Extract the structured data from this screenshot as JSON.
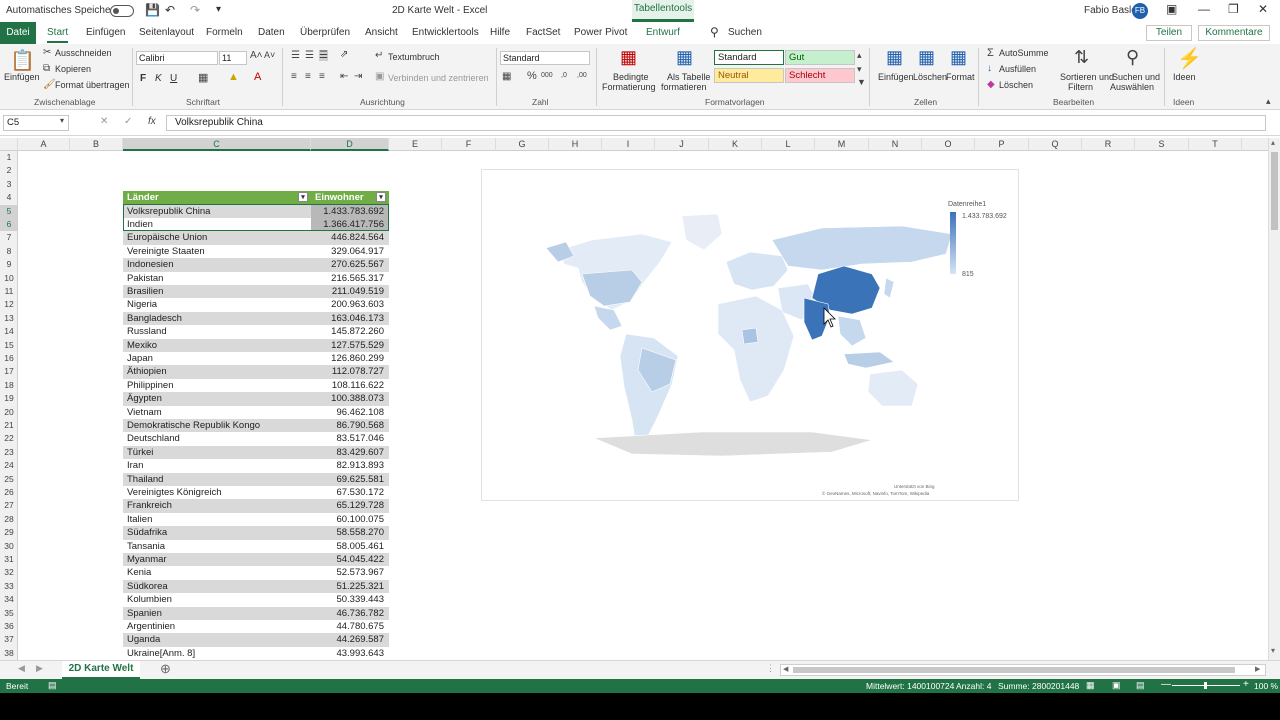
{
  "titlebar": {
    "autosave_label": "Automatisches Speichern",
    "doc_title": "2D Karte Welt  -  Excel",
    "context_tab": "Tabellentools",
    "user_name": "Fabio Basler",
    "user_initials": "FB"
  },
  "tabs": {
    "file": "Datei",
    "start": "Start",
    "insert": "Einfügen",
    "layout": "Seitenlayout",
    "formulas": "Formeln",
    "data": "Daten",
    "review": "Überprüfen",
    "view": "Ansicht",
    "developer": "Entwicklertools",
    "help": "Hilfe",
    "factset": "FactSet",
    "powerpivot": "Power Pivot",
    "design": "Entwurf",
    "search": "Suchen",
    "share": "Teilen",
    "comments": "Kommentare"
  },
  "ribbon": {
    "clipboard": {
      "paste": "Einfügen",
      "cut": "Ausschneiden",
      "copy": "Kopieren",
      "format_painter": "Format übertragen",
      "group": "Zwischenablage"
    },
    "font": {
      "name": "Calibri",
      "size": "11",
      "bold": "F",
      "italic": "K",
      "underline": "U",
      "group": "Schriftart"
    },
    "alignment": {
      "wrap": "Textumbruch",
      "merge": "Verbinden und zentrieren",
      "group": "Ausrichtung"
    },
    "number": {
      "format": "Standard",
      "group": "Zahl"
    },
    "styles": {
      "conditional": "Bedingte",
      "conditional2": "Formatierung",
      "as_table": "Als Tabelle",
      "as_table2": "formatieren",
      "standard": "Standard",
      "good": "Gut",
      "neutral": "Neutral",
      "bad": "Schlecht",
      "group": "Formatvorlagen"
    },
    "cells": {
      "insert": "Einfügen",
      "delete": "Löschen",
      "format": "Format",
      "group": "Zellen"
    },
    "editing": {
      "autosum": "AutoSumme",
      "fill": "Ausfüllen",
      "clear": "Löschen",
      "sort": "Sortieren und",
      "sort2": "Filtern",
      "find": "Suchen und",
      "find2": "Auswählen",
      "group": "Bearbeiten"
    },
    "ideas": {
      "label": "Ideen",
      "group": "Ideen"
    }
  },
  "formula_bar": {
    "name_box": "C5",
    "fx": "fx",
    "value": "Volksrepublik China"
  },
  "columns": [
    "A",
    "B",
    "C",
    "D",
    "E",
    "F",
    "G",
    "H",
    "I",
    "J",
    "K",
    "L",
    "M",
    "N",
    "O",
    "P",
    "Q",
    "R",
    "S",
    "T"
  ],
  "rows": [
    "1",
    "2",
    "3",
    "4",
    "5",
    "6",
    "7",
    "8",
    "9",
    "10",
    "11",
    "12",
    "13",
    "14",
    "15",
    "16",
    "17",
    "18",
    "19",
    "20",
    "21",
    "22",
    "23",
    "24",
    "25",
    "26",
    "27",
    "28",
    "29",
    "30",
    "31",
    "32",
    "33",
    "34",
    "35",
    "36",
    "37",
    "38"
  ],
  "table": {
    "headers": [
      "Länder",
      "Einwohner"
    ],
    "rows": [
      [
        "Volksrepublik China",
        "1.433.783.692"
      ],
      [
        "Indien",
        "1.366.417.756"
      ],
      [
        "Europäische Union",
        "446.824.564"
      ],
      [
        "Vereinigte Staaten",
        "329.064.917"
      ],
      [
        "Indonesien",
        "270.625.567"
      ],
      [
        "Pakistan",
        "216.565.317"
      ],
      [
        "Brasilien",
        "211.049.519"
      ],
      [
        "Nigeria",
        "200.963.603"
      ],
      [
        "Bangladesch",
        "163.046.173"
      ],
      [
        "Russland",
        "145.872.260"
      ],
      [
        "Mexiko",
        "127.575.529"
      ],
      [
        "Japan",
        "126.860.299"
      ],
      [
        "Äthiopien",
        "112.078.727"
      ],
      [
        "Philippinen",
        "108.116.622"
      ],
      [
        "Ägypten",
        "100.388.073"
      ],
      [
        "Vietnam",
        "96.462.108"
      ],
      [
        "Demokratische Republik Kongo",
        "86.790.568"
      ],
      [
        "Deutschland",
        "83.517.046"
      ],
      [
        "Türkei",
        "83.429.607"
      ],
      [
        "Iran",
        "82.913.893"
      ],
      [
        "Thailand",
        "69.625.581"
      ],
      [
        "Vereinigtes Königreich",
        "67.530.172"
      ],
      [
        "Frankreich",
        "65.129.728"
      ],
      [
        "Italien",
        "60.100.075"
      ],
      [
        "Südafrika",
        "58.558.270"
      ],
      [
        "Tansania",
        "58.005.461"
      ],
      [
        "Myanmar",
        "54.045.422"
      ],
      [
        "Kenia",
        "52.573.967"
      ],
      [
        "Südkorea",
        "51.225.321"
      ],
      [
        "Kolumbien",
        "50.339.443"
      ],
      [
        "Spanien",
        "46.736.782"
      ],
      [
        "Argentinien",
        "44.780.675"
      ],
      [
        "Uganda",
        "44.269.587"
      ],
      [
        "Ukraine[Anm. 8]",
        "43.993.643"
      ]
    ]
  },
  "map_chart": {
    "legend_title": "Datenreihe1",
    "legend_max": "1.433.783.692",
    "legend_min": "815",
    "credit1": "Unterstützt von Bing",
    "credit2": "© GeoNames, Microsoft, Navinfo, TomTom, Wikipedia"
  },
  "sheet_tab": "2D Karte Welt",
  "status": {
    "ready": "Bereit",
    "average": "Mittelwert: 1400100724",
    "count": "Anzahl: 4",
    "sum": "Summe: 2800201448",
    "zoom": "100 %"
  },
  "colors": {
    "excel_green": "#217346",
    "table_header": "#70ad47",
    "map_high": "#3b73b9",
    "map_low": "#d6e4f4"
  }
}
